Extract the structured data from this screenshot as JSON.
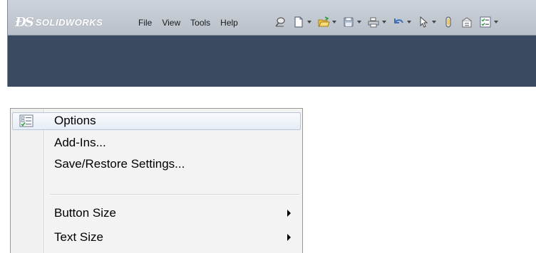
{
  "app": {
    "logo_brand": "SOLIDWORKS",
    "colors": {
      "titlebar": "#c4cad2",
      "workspace": "#3a4b61",
      "menu_background": "#f3f3f3",
      "highlight_border": "#b8c6da"
    }
  },
  "menubar": {
    "items": [
      {
        "label": "File"
      },
      {
        "label": "View"
      },
      {
        "label": "Tools"
      },
      {
        "label": "Help"
      }
    ]
  },
  "toolbar": {
    "icons": [
      "pin-icon",
      "new-document-icon",
      "open-folder-icon",
      "save-icon",
      "print-icon",
      "undo-icon",
      "select-cursor-icon",
      "rebuild-icon",
      "file-properties-icon",
      "options-icon"
    ]
  },
  "options_menu": {
    "items": [
      {
        "label": "Options",
        "icon": "options-checklist-icon",
        "highlighted": true,
        "submenu": false
      },
      {
        "label": "Add-Ins...",
        "submenu": false
      },
      {
        "label": "Save/Restore Settings...",
        "submenu": false
      },
      {
        "label": "Button Size",
        "submenu": true
      },
      {
        "label": "Text Size",
        "submenu": true
      }
    ]
  }
}
